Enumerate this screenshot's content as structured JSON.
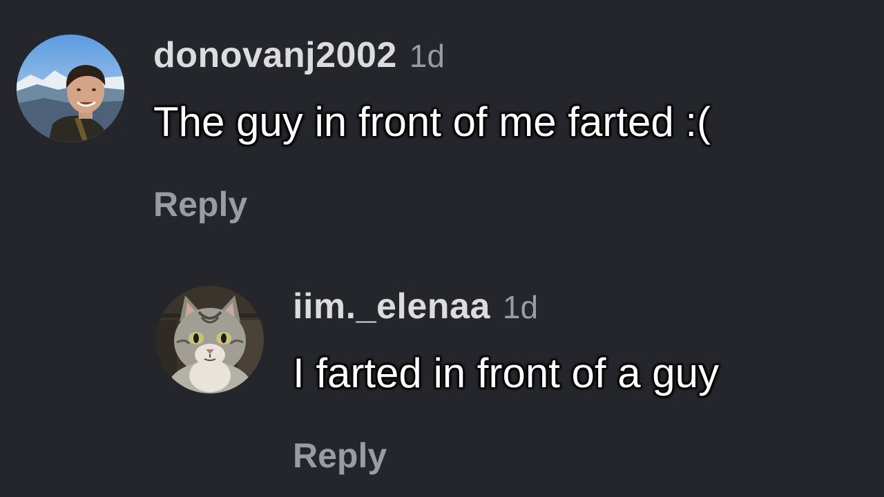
{
  "comments": [
    {
      "username": "donovanj2002",
      "time": "1d",
      "text": "The guy in front of me farted :(",
      "reply_label": "Reply",
      "avatar": "person-photo-avatar"
    },
    {
      "username": "iim._elenaa",
      "time": "1d",
      "text": "I farted in front of a guy",
      "reply_label": "Reply",
      "avatar": "cat-photo-avatar"
    }
  ],
  "colors": {
    "background": "#24262b",
    "username": "#dcdcdc",
    "secondary": "#9a9ca1",
    "text": "#ffffff"
  }
}
